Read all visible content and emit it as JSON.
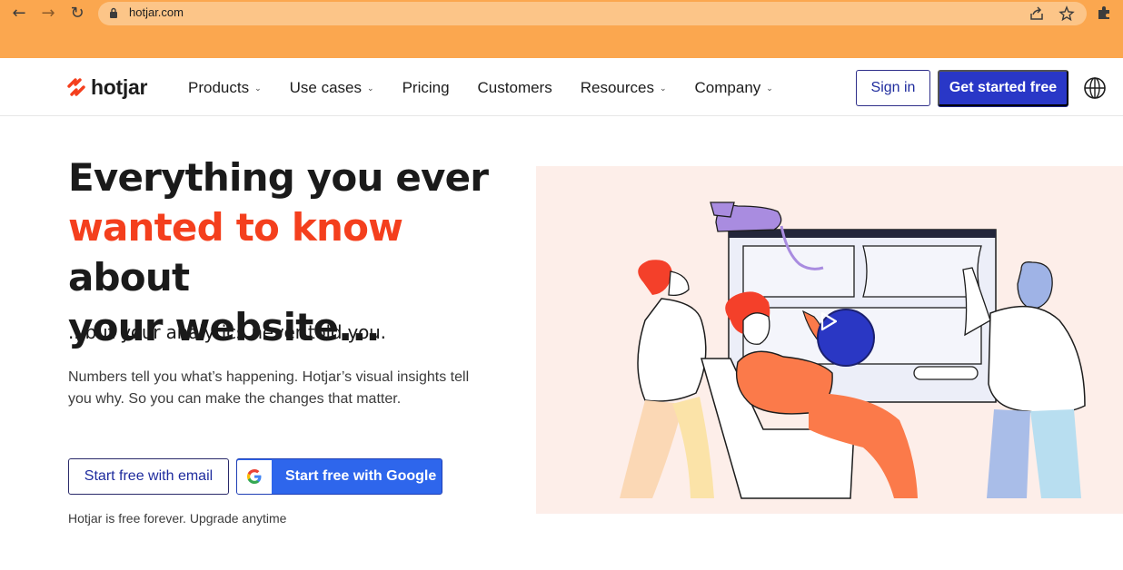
{
  "browser": {
    "url": "hotjar.com",
    "colors": {
      "tab_strip": "#fba74f",
      "omnibox": "#fcc588"
    },
    "icons": [
      "back-arrow-icon",
      "forward-arrow-icon",
      "reload-icon",
      "lock-icon",
      "share-icon",
      "star-icon",
      "extensions-puzzle-icon"
    ]
  },
  "header": {
    "logo_text": "hotjar",
    "nav": [
      {
        "label": "Products",
        "has_dropdown": true
      },
      {
        "label": "Use cases",
        "has_dropdown": true
      },
      {
        "label": "Pricing",
        "has_dropdown": false
      },
      {
        "label": "Customers",
        "has_dropdown": false
      },
      {
        "label": "Resources",
        "has_dropdown": true
      },
      {
        "label": "Company",
        "has_dropdown": true
      }
    ],
    "sign_in_label": "Sign in",
    "get_started_label": "Get started free",
    "language_icon": "globe-icon"
  },
  "hero": {
    "title_line1": "Everything you ever",
    "title_accent": "wanted to know",
    "title_after_accent": "about",
    "title_line3": "your website...",
    "subhead": "...but your analytics never told you.",
    "description": "Numbers tell you what’s happening. Hotjar’s visual insights tell you why. So you can make the changes that matter.",
    "cta_email": "Start free with email",
    "cta_google": "Start free with Google",
    "note": "Hotjar is free forever. Upgrade anytime",
    "colors": {
      "accent": "#f43f1d",
      "primary_button": "#2937c7",
      "google_button": "#2e66ec",
      "art_background": "#fdeee9"
    }
  }
}
